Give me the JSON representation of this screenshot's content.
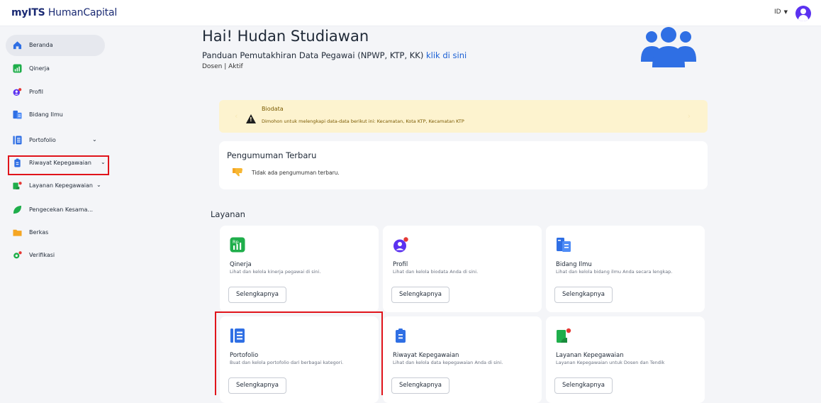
{
  "brand": {
    "prefix": "my",
    "accent": "ITS",
    "name": " HumanCapital"
  },
  "topbar": {
    "lang": "ID",
    "avatar_icon": "user-avatar-icon"
  },
  "colors": {
    "primary": "#5b32f0",
    "brand": "#1a2a73",
    "highlight": "#e0141b",
    "alert_bg": "#fdf3cf",
    "link": "#1a5fd4"
  },
  "sidebar": {
    "items": [
      {
        "label": "Beranda",
        "icon": "home-icon",
        "active": true
      },
      {
        "label": "Qinerja",
        "icon": "qinerja-icon"
      },
      {
        "label": "Profil",
        "icon": "profile-icon"
      },
      {
        "label": "Bidang Ilmu",
        "icon": "field-icon"
      },
      {
        "label": "Portofolio",
        "icon": "portfolio-icon",
        "expandable": true
      },
      {
        "label": "Riwayat Kepegawaian",
        "icon": "history-icon",
        "expandable": true
      },
      {
        "label": "Layanan Kepegawaian",
        "icon": "service-icon",
        "expandable": true
      },
      {
        "label": "Pengecekan Kesama...",
        "icon": "check-icon"
      },
      {
        "label": "Berkas",
        "icon": "folder-icon"
      },
      {
        "label": "Verifikasi",
        "icon": "verify-icon"
      }
    ]
  },
  "header": {
    "greeting": "Hai! Hudan Studiawan",
    "guide_text": "Panduan Pemutakhiran Data Pegawai (NPWP, KTP, KK) ",
    "guide_link": "klik di sini",
    "status": "Dosen | Aktif"
  },
  "alert": {
    "title": "Biodata",
    "message": "Dimohon untuk melengkapi data-data berikut ini: Kecamatan, Kota KTP, Kecamatan KTP"
  },
  "announcement": {
    "title": "Pengumuman Terbaru",
    "empty": "Tidak ada pengumuman terbaru."
  },
  "services": {
    "heading": "Layanan",
    "cards": [
      {
        "title": "Qinerja",
        "desc": "Lihat dan kelola kinerja pegawai di sini.",
        "button": "Selengkapnya",
        "icon": "qinerja-icon"
      },
      {
        "title": "Profil",
        "desc": "Lihat dan kelola biodata Anda di sini.",
        "button": "Selengkapnya",
        "icon": "profile-icon"
      },
      {
        "title": "Bidang Ilmu",
        "desc": "Lihat dan kelola bidang ilmu Anda secara lengkap.",
        "button": "Selengkapnya",
        "icon": "field-icon"
      },
      {
        "title": "Portofolio",
        "desc": "Buat dan kelola portofolio dari berbagai kategori.",
        "button": "Selengkapnya",
        "icon": "portfolio-icon"
      },
      {
        "title": "Riwayat Kepegawaian",
        "desc": "Lihat dan kelola data kepegawaian Anda di sini.",
        "button": "Selengkapnya",
        "icon": "history-icon"
      },
      {
        "title": "Layanan Kepegawaian",
        "desc": "Layanan Kepegawaian untuk Dosen dan Tendik",
        "button": "Selengkapnya",
        "icon": "service-icon"
      }
    ]
  }
}
